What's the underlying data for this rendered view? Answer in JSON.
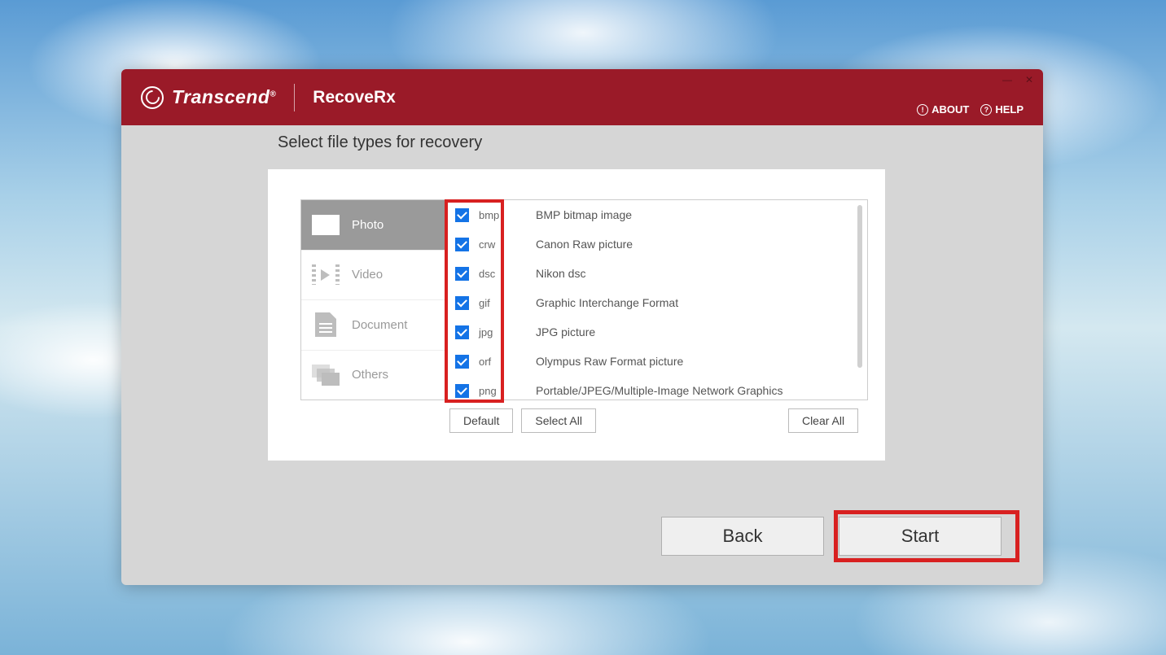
{
  "brand": {
    "name": "Transcend",
    "reg": "®",
    "app_name": "RecoveRx"
  },
  "titlebar": {
    "about": "ABOUT",
    "help": "HELP"
  },
  "page_title": "Select file types for recovery",
  "categories": [
    {
      "id": "photo",
      "label": "Photo",
      "active": true
    },
    {
      "id": "video",
      "label": "Video",
      "active": false
    },
    {
      "id": "document",
      "label": "Document",
      "active": false
    },
    {
      "id": "others",
      "label": "Others",
      "active": false
    }
  ],
  "filetypes": [
    {
      "ext": "bmp",
      "desc": "BMP bitmap image",
      "checked": true
    },
    {
      "ext": "crw",
      "desc": "Canon Raw picture",
      "checked": true
    },
    {
      "ext": "dsc",
      "desc": "Nikon dsc",
      "checked": true
    },
    {
      "ext": "gif",
      "desc": "Graphic Interchange Format",
      "checked": true
    },
    {
      "ext": "jpg",
      "desc": "JPG picture",
      "checked": true
    },
    {
      "ext": "orf",
      "desc": "Olympus Raw Format picture",
      "checked": true
    },
    {
      "ext": "png",
      "desc": "Portable/JPEG/Multiple-Image Network Graphics",
      "checked": true
    }
  ],
  "buttons": {
    "default": "Default",
    "select_all": "Select All",
    "clear_all": "Clear All",
    "back": "Back",
    "start": "Start"
  },
  "colors": {
    "brand_red": "#9a1a28",
    "highlight_red": "#d82020",
    "check_blue": "#1473e6"
  }
}
